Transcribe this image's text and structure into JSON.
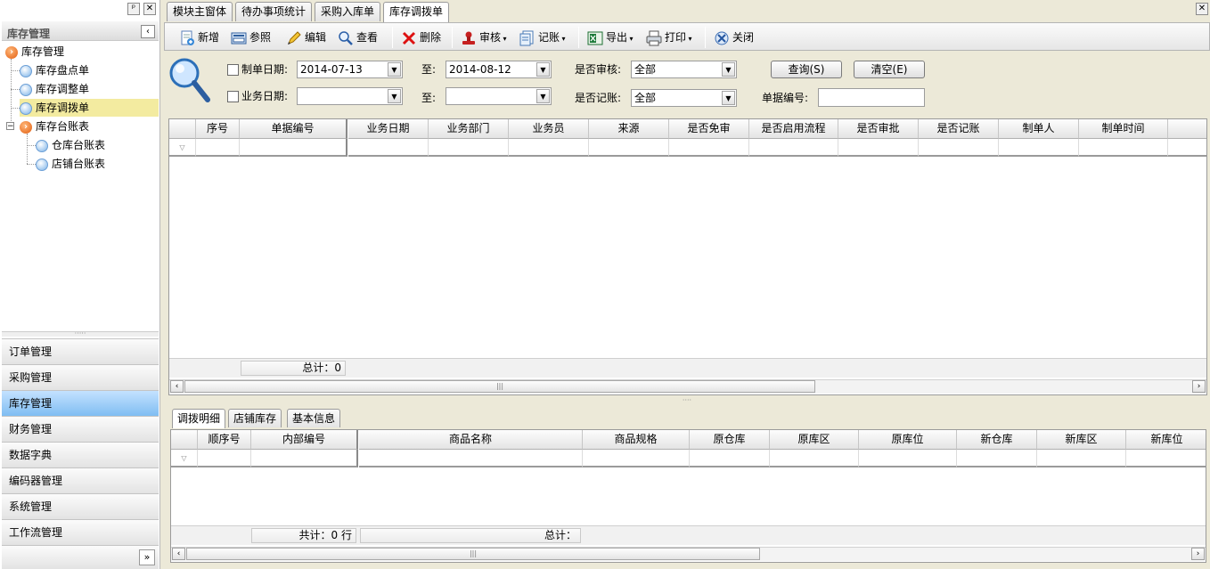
{
  "left_panel": {
    "title": "库存管理",
    "tree": {
      "root": "库存管理",
      "items": [
        "库存盘点单",
        "库存调整单",
        "库存调拨单"
      ],
      "group": "库存台账表",
      "group_items": [
        "仓库台账表",
        "店铺台账表"
      ]
    },
    "nav": [
      "订单管理",
      "采购管理",
      "库存管理",
      "财务管理",
      "数据字典",
      "编码器管理",
      "系统管理",
      "工作流管理"
    ]
  },
  "tabs": [
    "模块主窗体",
    "待办事项统计",
    "采购入库单",
    "库存调拨单"
  ],
  "toolbar": {
    "new": "新增",
    "ref": "参照",
    "edit": "编辑",
    "view": "查看",
    "delete": "删除",
    "audit": "审核",
    "post": "记账",
    "export": "导出",
    "print": "打印",
    "close": "关闭"
  },
  "filter": {
    "make_date_label": "制单日期:",
    "make_date_from": "2014-07-13",
    "to_label": "至:",
    "make_date_to": "2014-08-12",
    "biz_date_label": "业务日期:",
    "biz_date_from": "",
    "biz_date_to": "",
    "audited_label": "是否审核:",
    "audited_value": "全部",
    "posted_label": "是否记账:",
    "posted_value": "全部",
    "doc_no_label": "单据编号:",
    "doc_no_value": "",
    "query_btn": "查询(S)",
    "clear_btn": "清空(E)"
  },
  "main_grid": {
    "columns": [
      "序号",
      "单据编号",
      "业务日期",
      "业务部门",
      "业务员",
      "来源",
      "是否免审",
      "是否启用流程",
      "是否审批",
      "是否记账",
      "制单人",
      "制单时间"
    ],
    "rows": [],
    "footer_total": "总计：0"
  },
  "detail_tabs": [
    "调拨明细",
    "店铺库存",
    "基本信息"
  ],
  "detail_grid": {
    "columns": [
      "顺序号",
      "内部编号",
      "商品名称",
      "商品规格",
      "原仓库",
      "原库区",
      "原库位",
      "新仓库",
      "新库区",
      "新库位"
    ],
    "rows": [],
    "footer_count": "共计：0 行",
    "footer_total": "总计："
  }
}
